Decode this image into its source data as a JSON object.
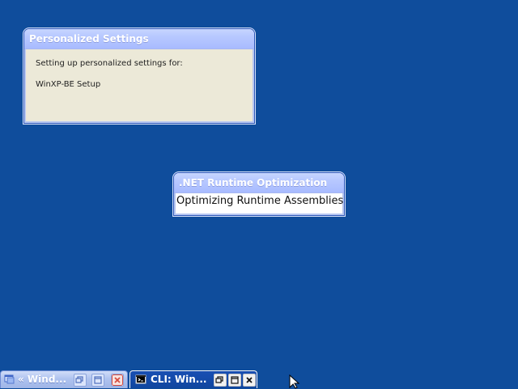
{
  "desktop": {
    "background": "#0f4d9c"
  },
  "personalized_settings": {
    "title": "Personalized Settings",
    "message_line_1": "Setting up personalized settings for:",
    "message_line_2": "WinXP-BE Setup"
  },
  "dotnet_runtime": {
    "title": ".NET Runtime Optimization",
    "status": "Optimizing Runtime Assemblies"
  },
  "taskbar": {
    "items": [
      {
        "label": "« Wind...",
        "icon": "window-icon",
        "controls": [
          "restore-icon",
          "maximize-icon",
          "close-icon"
        ]
      },
      {
        "label": "CLI: Win...",
        "icon": "console-icon",
        "controls": [
          "restore-icon",
          "maximize-icon",
          "close-icon"
        ]
      }
    ]
  },
  "colors": {
    "titlebar": "#b8c9ff",
    "window_body": "#ece9d8",
    "active_task": "#10469f",
    "inactive_task": "#afc3ef",
    "close_red": "#d84c3e"
  }
}
